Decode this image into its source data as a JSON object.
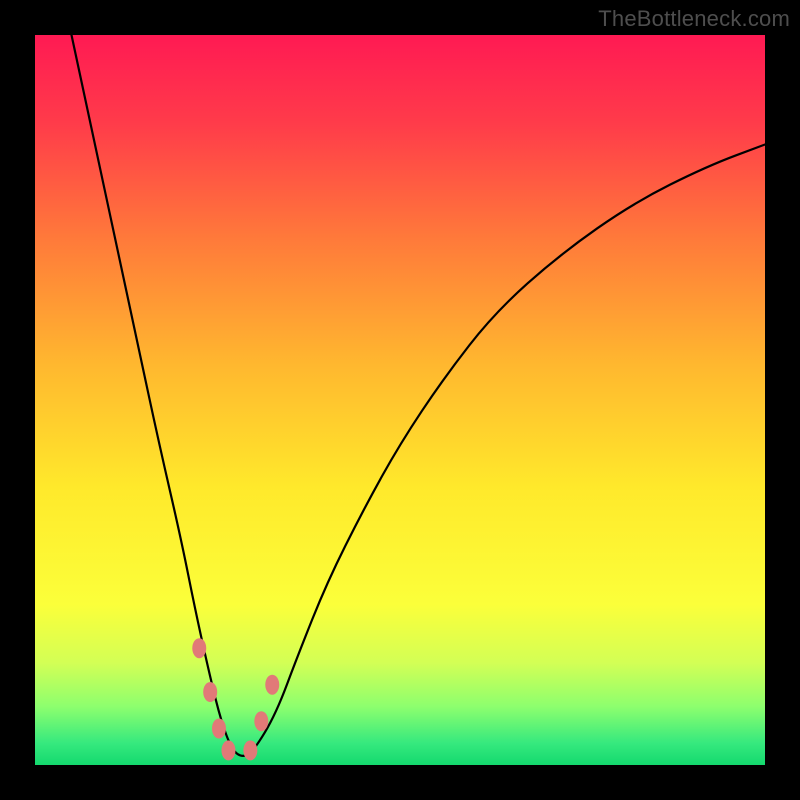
{
  "watermark": "TheBottleneck.com",
  "chart_data": {
    "type": "line",
    "title": "",
    "xlabel": "",
    "ylabel": "",
    "xlim": [
      0,
      100
    ],
    "ylim": [
      0,
      100
    ],
    "grid": false,
    "series": [
      {
        "name": "bottleneck-curve",
        "x": [
          5,
          8,
          11,
          14,
          17,
          20,
          22,
          24,
          25.5,
          27,
          28.5,
          30,
          33,
          36,
          40,
          45,
          50,
          56,
          63,
          72,
          82,
          92,
          100
        ],
        "y": [
          100,
          86,
          72,
          58,
          44,
          31,
          21,
          12,
          6,
          2,
          1,
          2,
          7,
          15,
          25,
          35,
          44,
          53,
          62,
          70,
          77,
          82,
          85
        ]
      }
    ],
    "markers": [
      {
        "name": "pt-left-high",
        "x": 22.5,
        "y": 16
      },
      {
        "name": "pt-left-mid",
        "x": 24.0,
        "y": 10
      },
      {
        "name": "pt-left-low",
        "x": 25.2,
        "y": 5
      },
      {
        "name": "pt-valley-l",
        "x": 26.5,
        "y": 2
      },
      {
        "name": "pt-valley-r",
        "x": 29.5,
        "y": 2
      },
      {
        "name": "pt-right-low",
        "x": 31.0,
        "y": 6
      },
      {
        "name": "pt-right-high",
        "x": 32.5,
        "y": 11
      }
    ],
    "gradient_stops": [
      {
        "offset": 0.0,
        "color": "#ff1a53"
      },
      {
        "offset": 0.12,
        "color": "#ff3b4a"
      },
      {
        "offset": 0.28,
        "color": "#ff7a3a"
      },
      {
        "offset": 0.45,
        "color": "#ffb72f"
      },
      {
        "offset": 0.62,
        "color": "#ffe92b"
      },
      {
        "offset": 0.78,
        "color": "#fbff3a"
      },
      {
        "offset": 0.86,
        "color": "#d3ff55"
      },
      {
        "offset": 0.92,
        "color": "#8dff6e"
      },
      {
        "offset": 0.97,
        "color": "#36e97e"
      },
      {
        "offset": 1.0,
        "color": "#14d96e"
      }
    ],
    "marker_style": {
      "fill": "#e17a78",
      "rx": 7,
      "ry": 10
    }
  }
}
